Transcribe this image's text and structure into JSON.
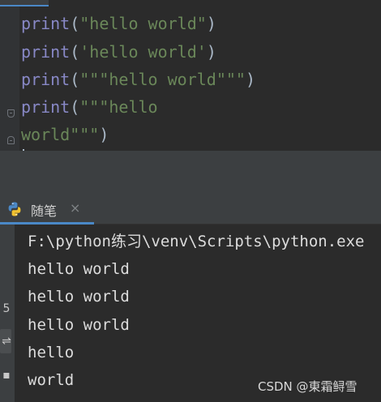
{
  "editor": {
    "lines": [
      {
        "fn": "print",
        "open": "(",
        "str": "\"hello world\"",
        "close": ")"
      },
      {
        "fn": "print",
        "open": "(",
        "str": "'hello world'",
        "close": ")"
      },
      {
        "fn": "print",
        "open": "(",
        "str": "\"\"\"hello world\"\"\"",
        "close": ")"
      },
      {
        "fn": "print",
        "open": "(",
        "str": "\"\"\"hello",
        "close": ""
      },
      {
        "fn": "",
        "open": "",
        "str": "world\"\"\"",
        "close": ")"
      }
    ]
  },
  "run_panel": {
    "tab_label": "随笔",
    "close_glyph": "×",
    "side_glyphs": [
      "5",
      "⇌",
      "▪"
    ]
  },
  "console": {
    "lines": [
      "F:\\python练习\\venv\\Scripts\\python.exe",
      "hello world",
      "hello world",
      "hello world",
      "hello",
      "world"
    ]
  },
  "watermark": "CSDN @東霜鲟雪",
  "colors": {
    "background": "#2b2b2b",
    "keyword": "#8888c6",
    "string": "#6a8759",
    "text": "#a9b7c6",
    "accent": "#4a88c7"
  }
}
